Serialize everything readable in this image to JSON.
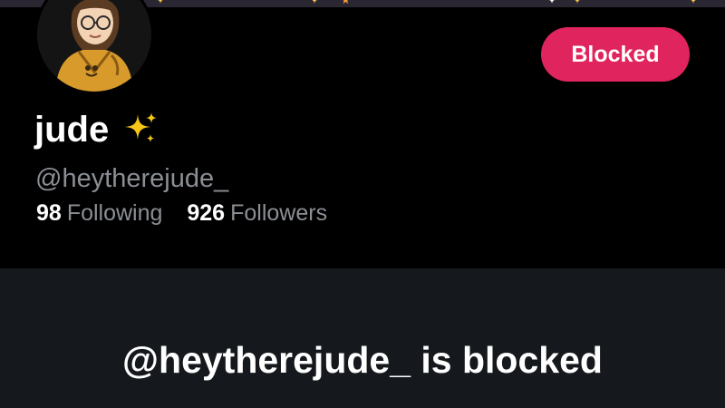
{
  "profile": {
    "display_name": "jude",
    "name_emoji": "sparkles-icon",
    "handle": "@heytherejude_",
    "following_count": "98",
    "following_label": "Following",
    "followers_count": "926",
    "followers_label": "Followers"
  },
  "actions": {
    "blocked_label": "Blocked"
  },
  "blocked_notice": {
    "title": "@heytherejude_ is blocked"
  },
  "colors": {
    "background": "#000000",
    "panel": "#15181c",
    "accent_blocked": "#e0245e",
    "secondary_text": "#8b8f94",
    "primary_text": "#ffffff",
    "sparkle": "#f5c518"
  }
}
